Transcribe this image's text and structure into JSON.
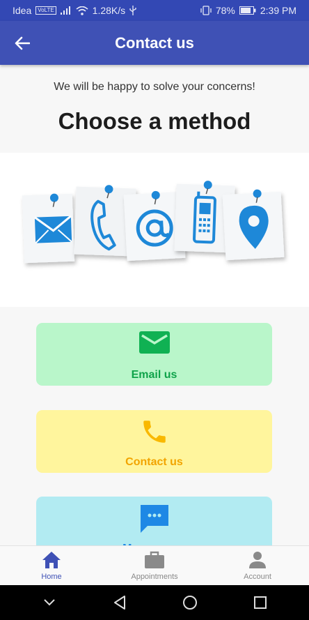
{
  "status_bar": {
    "carrier": "Idea",
    "volte": "VoLTE",
    "speed": "1.28K/s",
    "battery": "78%",
    "time": "2:39 PM"
  },
  "app_bar": {
    "title": "Contact us",
    "back_icon": "arrow-back-icon"
  },
  "intro": {
    "subtitle": "We will be happy to solve your concerns!",
    "heading": "Choose a method"
  },
  "methods": [
    {
      "label": "Email us",
      "icon": "email-icon",
      "bg": "#b9f6ca",
      "color": "#0fa34a"
    },
    {
      "label": "Contact us",
      "icon": "phone-icon",
      "bg": "#fff59d",
      "color": "#f2a400"
    },
    {
      "label": "Message us",
      "icon": "chat-icon",
      "bg": "#b2ebf2",
      "color": "#1e88e5"
    }
  ],
  "bottom_nav": [
    {
      "label": "Home",
      "icon": "home-icon",
      "active": true
    },
    {
      "label": "Appointments",
      "icon": "briefcase-icon",
      "active": false
    },
    {
      "label": "Account",
      "icon": "person-icon",
      "active": false
    }
  ],
  "colors": {
    "primary": "#3f51b5",
    "status_bar": "#3348b4",
    "banner_icon": "#1e88d8"
  }
}
